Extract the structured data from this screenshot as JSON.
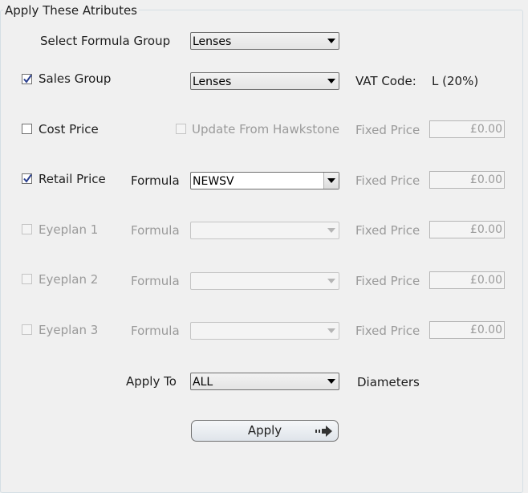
{
  "group_title": "Apply These Atributes",
  "select_formula_group": {
    "label": "Select Formula Group",
    "value": "Lenses"
  },
  "sales_group": {
    "label": "Sales Group",
    "checked": true,
    "value": "Lenses",
    "vat_label": "VAT Code:",
    "vat_value": "L (20%)"
  },
  "cost_price": {
    "label": "Cost Price",
    "checked": false,
    "update_label": "Update From Hawkstone",
    "fixed_label": "Fixed Price",
    "fixed_value": "£0.00"
  },
  "retail_price": {
    "label": "Retail Price",
    "checked": true,
    "formula_label": "Formula",
    "formula_value": "NEWSV",
    "fixed_label": "Fixed Price",
    "fixed_value": "£0.00"
  },
  "eyeplan1": {
    "label": "Eyeplan 1",
    "checked": false,
    "formula_label": "Formula",
    "fixed_label": "Fixed Price",
    "fixed_value": "£0.00"
  },
  "eyeplan2": {
    "label": "Eyeplan 2",
    "checked": false,
    "formula_label": "Formula",
    "fixed_label": "Fixed Price",
    "fixed_value": "£0.00"
  },
  "eyeplan3": {
    "label": "Eyeplan 3",
    "checked": false,
    "formula_label": "Formula",
    "fixed_label": "Fixed Price",
    "fixed_value": "£0.00"
  },
  "apply_to": {
    "label": "Apply To",
    "value": "ALL",
    "suffix": "Diameters"
  },
  "apply_button": {
    "label": "Apply",
    "icon": "arrow-right-icon"
  }
}
